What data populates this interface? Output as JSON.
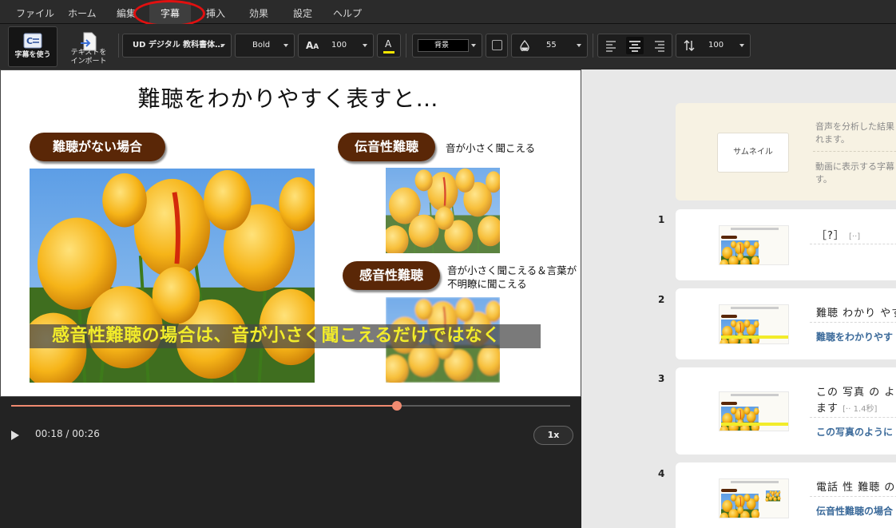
{
  "menu": {
    "items": [
      "ファイル",
      "ホーム",
      "編集",
      "字幕",
      "挿入",
      "効果",
      "設定",
      "ヘルプ"
    ],
    "active": "字幕"
  },
  "toolbar": {
    "use_subtitles_label": "字幕を使う",
    "import_text_label_1": "テキストを",
    "import_text_label_2": "インポート",
    "font_value": "UD デジタル 教科書体…",
    "weight_value": "Bold",
    "font_size_value": "100",
    "background_value": "背景",
    "opacity_value": "55",
    "line_spacing_value": "100",
    "icons": [
      "subtitle-doc-icon",
      "import-text-icon",
      "font-size-icon",
      "text-color-icon",
      "color-swatch-icon",
      "opacity-drop-icon",
      "align-left-icon",
      "align-center-icon",
      "align-right-icon",
      "line-spacing-icon"
    ],
    "colors": {
      "accent": "#ef8a70",
      "text_color_underline": "#f2e500"
    }
  },
  "slide": {
    "title": "難聴をわかりやすく表すと…",
    "pill_no_loss": "難聴がない場合",
    "pill_conductive": "伝音性難聴",
    "conductive_desc": "音が小さく聞こえる",
    "pill_sensorineural": "感音性難聴",
    "sensorineural_desc_1": "音が小さく聞こえる＆言葉が",
    "sensorineural_desc_2": "不明瞭に聞こえる",
    "subtitle": "感音性難聴の場合は、音が小さく聞こえるだけではなく",
    "colors": {
      "pill": "#5a2707",
      "subtitle": "#f2ec2a"
    }
  },
  "player": {
    "time": "00:18 / 00:26",
    "progress": 0.69,
    "speed": "1x"
  },
  "panel": {
    "thumbnail_button": "サムネイル",
    "info_line_1": "音声を分析した結果",
    "info_line_2": "れます。",
    "info_line_3": "動画に表示する字幕",
    "info_line_4": "す。",
    "rows": [
      {
        "num": "1",
        "line1": "［?］",
        "line1_dim": "[··]",
        "line2": ""
      },
      {
        "num": "2",
        "line1": "難聴 わかり やす",
        "line1_dim": "",
        "line2": "難聴をわかりやす"
      },
      {
        "num": "3",
        "line1": "この 写真 の よう",
        "line1b": "ます",
        "line1_dim": "[·· 1.4秒]",
        "line2": "この写真のように"
      },
      {
        "num": "4",
        "line1": "電話 性 難聴 の",
        "line1_dim": "",
        "line2": "伝音性難聴の場合"
      }
    ]
  }
}
